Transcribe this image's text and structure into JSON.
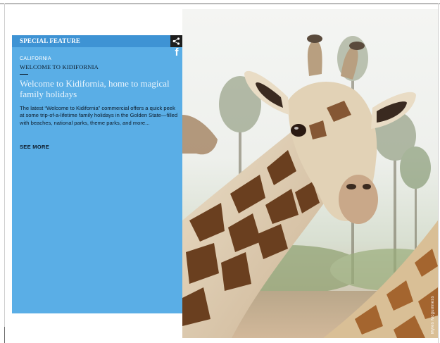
{
  "feature": {
    "header_label": "SPECIAL FEATURE",
    "kicker": "CALIFORNIA",
    "subtitle": "WELCOME TO KIDIFORNIA",
    "headline": "Welcome to Kidifornia, home to magical family holidays",
    "body": "The latest “Welcome to Kidifornia” commercial offers a quick peek at some trip-of-a-lifetime family holidays in the Golden State—filled with beaches, national parks, theme parks, and more...",
    "cta_label": "SEE MORE"
  },
  "social": {
    "share_icon": "share-icon",
    "facebook_icon": "facebook-icon",
    "facebook_glyph": "f"
  },
  "hero": {
    "photo_credit": "Myles Mcguinness"
  },
  "colors": {
    "panel": "#5aaee6",
    "panel_header": "#3e93d4",
    "share_button": "#1e1e1e"
  }
}
